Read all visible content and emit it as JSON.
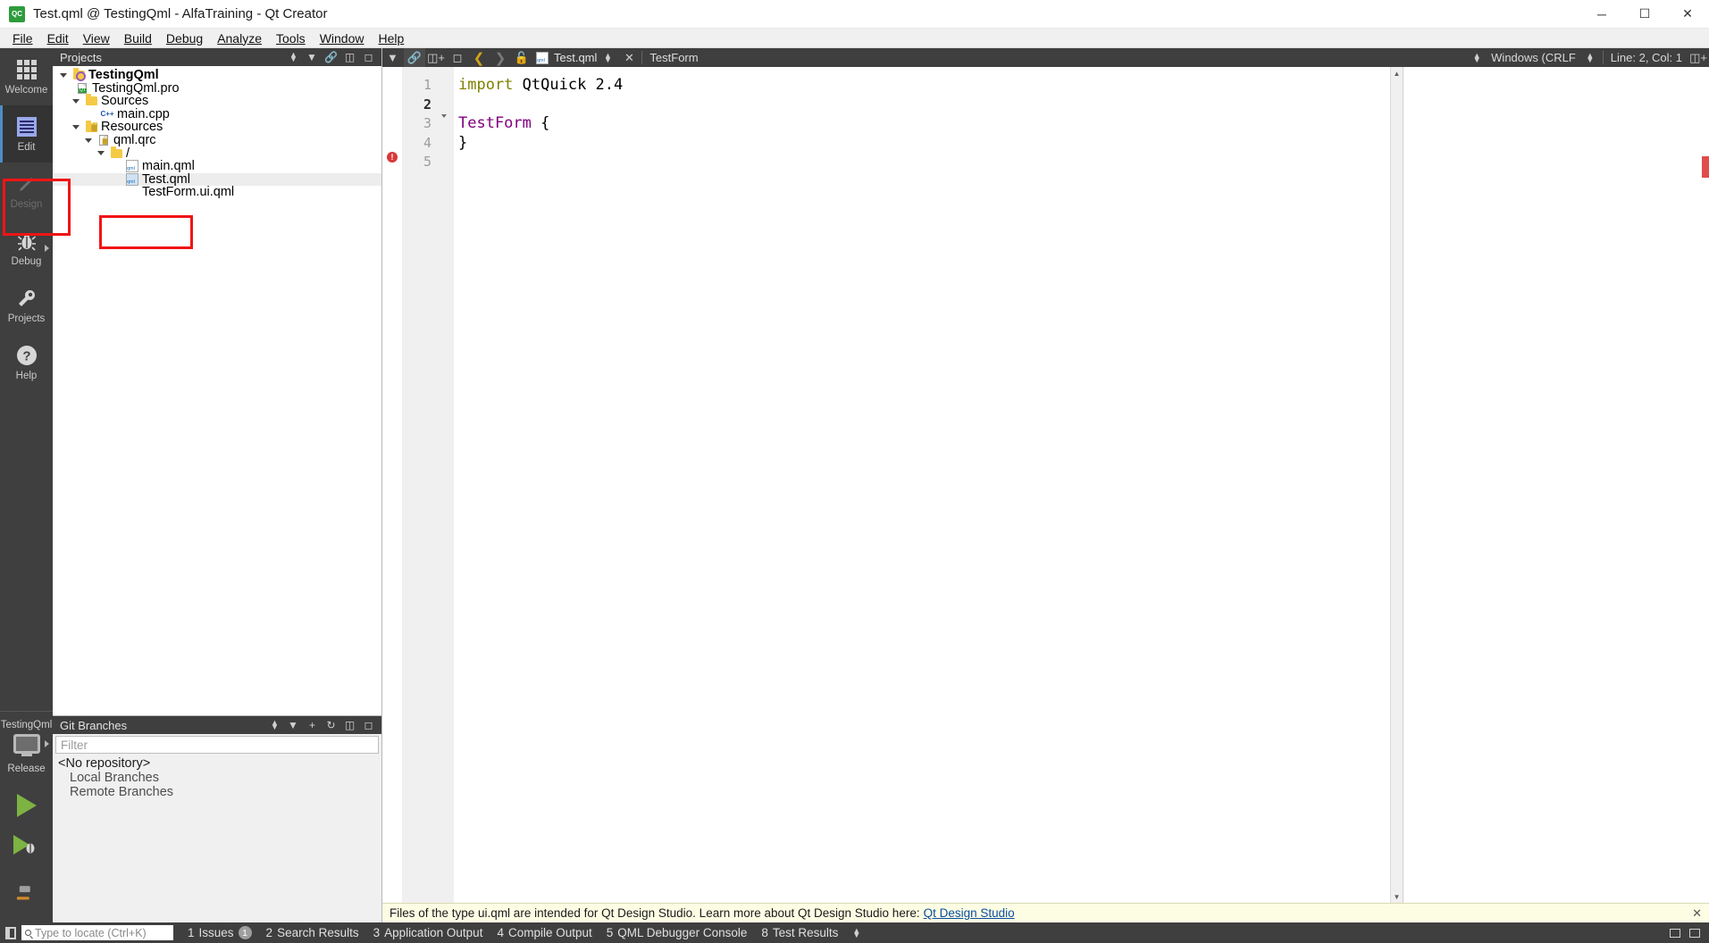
{
  "window": {
    "title": "Test.qml @ TestingQml - AlfaTraining - Qt Creator",
    "icon": "qt-creator-icon",
    "minimize": "─",
    "maximize": "☐",
    "close": "✕"
  },
  "menubar": [
    {
      "label": "File",
      "mnemonic": "F"
    },
    {
      "label": "Edit",
      "mnemonic": "E"
    },
    {
      "label": "View",
      "mnemonic": "V"
    },
    {
      "label": "Build",
      "mnemonic": "B"
    },
    {
      "label": "Debug",
      "mnemonic": "D"
    },
    {
      "label": "Analyze",
      "mnemonic": "A"
    },
    {
      "label": "Tools",
      "mnemonic": "T"
    },
    {
      "label": "Window",
      "mnemonic": "W"
    },
    {
      "label": "Help",
      "mnemonic": "H"
    }
  ],
  "modebar": {
    "items": [
      {
        "label": "Welcome",
        "icon": "grid-icon",
        "state": "normal"
      },
      {
        "label": "Edit",
        "icon": "document-lines-icon",
        "state": "active"
      },
      {
        "label": "Design",
        "icon": "pencil-icon",
        "state": "disabled"
      },
      {
        "label": "Debug",
        "icon": "bug-icon",
        "state": "normal"
      },
      {
        "label": "Projects",
        "icon": "wrench-icon",
        "state": "normal"
      },
      {
        "label": "Help",
        "icon": "question-mark-icon",
        "state": "normal"
      }
    ],
    "kit": {
      "project": "TestingQml",
      "configuration": "Release",
      "target_icon": "monitor-icon",
      "run_label": "run-button",
      "debug_label": "run-debug-button",
      "build_label": "build-hammer-button"
    }
  },
  "projects_panel": {
    "title": "Projects",
    "toolbar_icons": [
      "filter-icon",
      "split-icon",
      "close-icon"
    ],
    "tree": [
      {
        "label": "TestingQml",
        "depth": 0,
        "icon": "project-gear-icon",
        "twist": true,
        "bold": true,
        "selected": false
      },
      {
        "label": "TestingQml.pro",
        "depth": 1,
        "icon": "pro-file-icon",
        "twist": false,
        "bold": false,
        "selected": false
      },
      {
        "label": "Sources",
        "depth": 1,
        "icon": "folder-cpp-icon",
        "twist": true,
        "bold": false,
        "selected": false
      },
      {
        "label": "main.cpp",
        "depth": 2,
        "icon": "cpp-file-icon",
        "twist": false,
        "bold": false,
        "selected": false
      },
      {
        "label": "Resources",
        "depth": 1,
        "icon": "folder-lock-icon",
        "twist": true,
        "bold": false,
        "selected": false
      },
      {
        "label": "qml.qrc",
        "depth": 2,
        "icon": "qrc-file-icon",
        "twist": true,
        "bold": false,
        "selected": false
      },
      {
        "label": "/",
        "depth": 3,
        "icon": "folder-icon",
        "twist": true,
        "bold": false,
        "selected": false
      },
      {
        "label": "main.qml",
        "depth": 4,
        "icon": "qml-file-icon",
        "twist": false,
        "bold": false,
        "selected": false
      },
      {
        "label": "Test.qml",
        "depth": 4,
        "icon": "qml-file-icon",
        "twist": false,
        "bold": false,
        "selected": true
      },
      {
        "label": "TestForm.ui.qml",
        "depth": 4,
        "icon": "none",
        "twist": false,
        "bold": false,
        "selected": false
      }
    ],
    "annotation": "red-highlight-box"
  },
  "git_panel": {
    "title": "Git Branches",
    "toolbar_icons": [
      "filter-icon",
      "add-icon",
      "refresh-icon",
      "split-icon",
      "close-icon"
    ],
    "filter_placeholder": "Filter",
    "rows": [
      {
        "label": "<No repository>",
        "indent": false
      },
      {
        "label": "Local Branches",
        "indent": true
      },
      {
        "label": "Remote Branches",
        "indent": true
      }
    ]
  },
  "editor": {
    "toolbar": {
      "back_icon": "chevron-left-icon",
      "forward_icon": "chevron-right-icon",
      "lock_icon": "unlocked-icon",
      "split_icon": "split-icon",
      "unsplit_icon": "unsplit-icon",
      "link_icon": "link-icon",
      "file_icon": "qml-file-icon",
      "filename": "Test.qml",
      "file_close": "✕",
      "symbol": "TestForm",
      "line_ending": "Windows (CRLF",
      "cursor_position": "Line: 2, Col: 1",
      "add_split_icon": "add-split-icon"
    },
    "code_lines": [
      {
        "num": "1",
        "current": false,
        "fold": false,
        "error": false,
        "tokens": [
          {
            "t": "import",
            "c": "k-import"
          },
          {
            "t": " QtQuick 2.4",
            "c": "k-plain"
          }
        ]
      },
      {
        "num": "2",
        "current": true,
        "fold": false,
        "error": false,
        "tokens": []
      },
      {
        "num": "3",
        "current": false,
        "fold": true,
        "error": false,
        "tokens": [
          {
            "t": "TestForm",
            "c": "k-type"
          },
          {
            "t": " {",
            "c": "k-plain"
          }
        ]
      },
      {
        "num": "4",
        "current": false,
        "fold": false,
        "error": false,
        "tokens": [
          {
            "t": "}",
            "c": "k-plain"
          }
        ]
      },
      {
        "num": "5",
        "current": false,
        "fold": false,
        "error": true,
        "tokens": []
      }
    ]
  },
  "infobar": {
    "message": "Files of the type ui.qml are intended for Qt Design Studio. Learn more about Qt Design Studio here:",
    "link": "Qt Design Studio",
    "close": "✕"
  },
  "statusbar": {
    "sidebar_toggle": "sidebar-toggle-icon",
    "locator_placeholder": "Type to locate (Ctrl+K)",
    "panes": [
      {
        "num": "1",
        "label": "Issues",
        "badge": "1"
      },
      {
        "num": "2",
        "label": "Search Results",
        "badge": ""
      },
      {
        "num": "3",
        "label": "Application Output",
        "badge": ""
      },
      {
        "num": "4",
        "label": "Compile Output",
        "badge": ""
      },
      {
        "num": "5",
        "label": "QML Debugger Console",
        "badge": ""
      },
      {
        "num": "8",
        "label": "Test Results",
        "badge": ""
      }
    ],
    "right_icons": [
      "progress-icon",
      "maximize-output-icon"
    ]
  },
  "colors": {
    "accent": "#4e8cc7",
    "annotation_red": "#f11414",
    "error_red": "#d9383a",
    "keyword_olive": "#808000",
    "type_purple": "#800080",
    "dock_dark": "#3f3f3f",
    "mode_dark": "#3f3f3f",
    "run_green": "#7cb342",
    "info_yellow": "#fdfde4",
    "link_blue": "#0b4ea2"
  }
}
